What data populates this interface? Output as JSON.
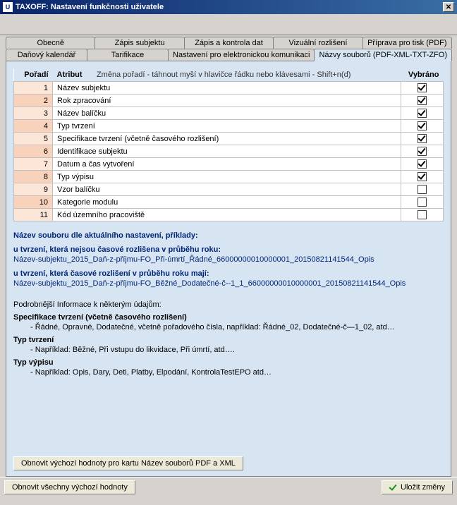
{
  "window": {
    "title": "TAXOFF: Nastavení funkčnosti uživatele",
    "icon_text": "U"
  },
  "tabs": {
    "row1": [
      {
        "label": "Obecně"
      },
      {
        "label": "Zápis subjektu"
      },
      {
        "label": "Zápis a kontrola dat"
      },
      {
        "label": "Vizuální rozlišení"
      },
      {
        "label": "Příprava pro tisk (PDF)"
      }
    ],
    "row2": [
      {
        "label": "Daňový kalendář"
      },
      {
        "label": "Tarifikace"
      },
      {
        "label": "Nastavení pro elektronickou komunikaci"
      },
      {
        "label": "Názvy souborů (PDF-XML-TXT-ZFO)",
        "active": true
      }
    ]
  },
  "grid": {
    "headers": {
      "poradi": "Pořadí",
      "atribut": "Atribut",
      "hint": "Změna pořadí - táhnout myší v hlavičce řádku nebo klávesami - Shift+n(d)",
      "vybrano": "Vybráno"
    },
    "rows": [
      {
        "n": "1",
        "attr": "Název subjektu",
        "checked": true
      },
      {
        "n": "2",
        "attr": "Rok zpracování",
        "checked": true
      },
      {
        "n": "3",
        "attr": "Název balíčku",
        "checked": true
      },
      {
        "n": "4",
        "attr": "Typ tvrzení",
        "checked": true
      },
      {
        "n": "5",
        "attr": "Specifikace tvrzení (včetně časového rozlišení)",
        "checked": true
      },
      {
        "n": "6",
        "attr": "Identifikace subjektu",
        "checked": true
      },
      {
        "n": "7",
        "attr": "Datum a čas vytvoření",
        "checked": true
      },
      {
        "n": "8",
        "attr": "Typ výpisu",
        "checked": true
      },
      {
        "n": "9",
        "attr": "Vzor balíčku",
        "checked": false
      },
      {
        "n": "10",
        "attr": "Kategorie modulu",
        "checked": false
      },
      {
        "n": "11",
        "attr": "Kód územního pracoviště",
        "checked": false
      }
    ]
  },
  "examples": {
    "heading": "Název souboru dle aktuálního nastavení, příklady:",
    "block1_title": "u tvrzení, která nejsou časové rozlišena v průběhu roku:",
    "block1_example": "Název-subjektu_2015_Daň-z-příjmu-FO_Při-úmrtí_Řádné_66000000010000001_20150821141544_Opis",
    "block2_title": "u tvrzení, která časové rozlišení v průběhu roku mají:",
    "block2_example": "Název-subjektu_2015_Daň-z-příjmu-FO_Běžné_Dodatečné-č--1_1_66000000010000001_20150821141544_Opis"
  },
  "details": {
    "heading": "Podrobnější Informace k některým údajům:",
    "items": [
      {
        "title": "Specifikace tvrzení (včetně časového rozlišení)",
        "text": "- Řádné, Opravné, Dodatečné, včetně pořadového čísla, například: Řádné_02, Dodatečné-č—1_02, atd…"
      },
      {
        "title": "Typ tvrzení",
        "text": "- Například: Běžné, Při vstupu do likvidace, Při úmrtí, atd…."
      },
      {
        "title": "Typ výpisu",
        "text": "- Například: Opis, Dary, Deti, Platby, Elpodání, KontrolaTestEPO atd…"
      }
    ]
  },
  "buttons": {
    "restore_tab": "Obnovit výchozí hodnoty pro kartu Název souborů PDF a XML",
    "restore_all": "Obnovit všechny výchozí hodnoty",
    "save": "Uložit změny"
  }
}
